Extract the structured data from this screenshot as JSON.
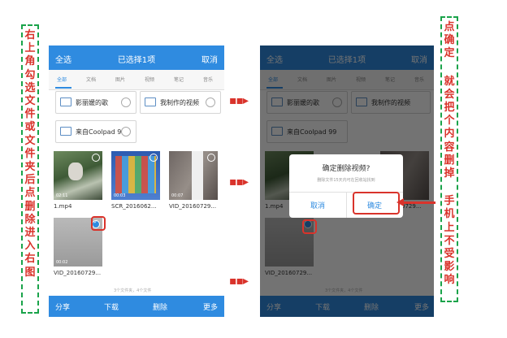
{
  "left_note": [
    "右",
    "上",
    "角",
    "勾",
    "选",
    "文",
    "件",
    "或",
    "文",
    "件",
    "夹",
    "后",
    "点",
    "删",
    "除",
    "进",
    "入",
    "右",
    "图"
  ],
  "right_note_top": [
    "点",
    "确",
    "定"
  ],
  "right_note_mid": [
    "就",
    "会",
    "把",
    "个",
    "内",
    "容",
    "删",
    "掉"
  ],
  "right_note_bottom": [
    "手",
    "机",
    "上",
    "不",
    "受",
    "影",
    "响"
  ],
  "phone": {
    "select_all": "全选",
    "title": "已选择1项",
    "cancel": "取消",
    "tabs": [
      "全部",
      "文档",
      "图片",
      "视频",
      "笔记",
      "音乐"
    ],
    "folders": [
      "影丽媛的歌",
      "我制作的视频",
      "来自Coolpad 99"
    ],
    "files": [
      {
        "name": "1.mp4",
        "duration": "02:11"
      },
      {
        "name": "SCR_2016062...",
        "duration": "00:03"
      },
      {
        "name": "VID_20160729...",
        "duration": "00:07"
      },
      {
        "name": "VID_20160729...",
        "duration": "00:02"
      }
    ],
    "count_text": "3个文件夹，4个文件",
    "bottom": [
      "分享",
      "下载",
      "删除",
      "更多"
    ]
  },
  "dialog": {
    "title": "确定删除视频?",
    "message": "删除文件15天内可在回收站找到",
    "cancel": "取消",
    "confirm": "确定"
  },
  "arrow_glyph": "▪▪▸",
  "colors": {
    "accent": "#2f8be0",
    "annotation": "#d9332b",
    "border": "#1aa34a"
  }
}
